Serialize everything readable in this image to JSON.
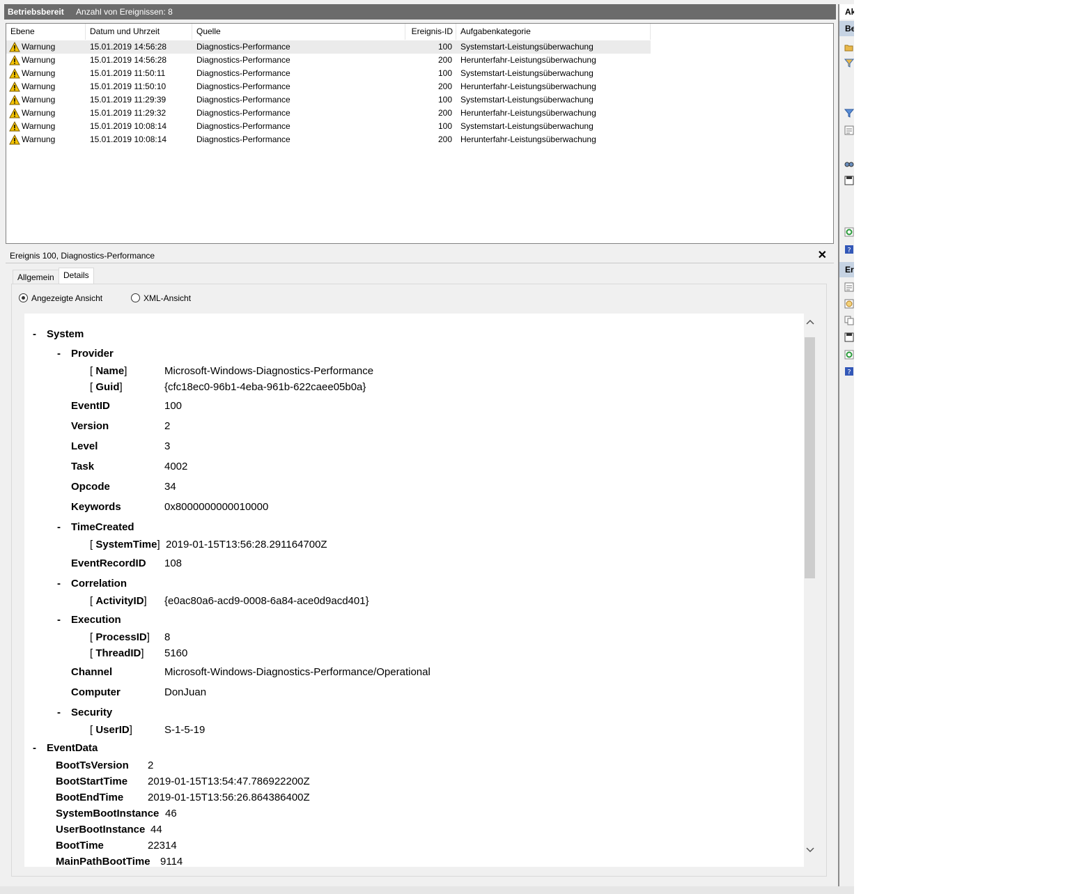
{
  "header": {
    "title": "Betriebsbereit",
    "event_count": "Anzahl von Ereignissen: 8"
  },
  "event_list": {
    "columns": [
      "Ebene",
      "Datum und Uhrzeit",
      "Quelle",
      "Ereignis-ID",
      "Aufgabenkategorie"
    ],
    "rows": [
      {
        "level": "Warnung",
        "datetime": "15.01.2019 14:56:28",
        "source": "Diagnostics-Performance",
        "id": "100",
        "category": "Systemstart-Leistungsüberwachung"
      },
      {
        "level": "Warnung",
        "datetime": "15.01.2019 14:56:28",
        "source": "Diagnostics-Performance",
        "id": "200",
        "category": "Herunterfahr-Leistungsüberwachung"
      },
      {
        "level": "Warnung",
        "datetime": "15.01.2019 11:50:11",
        "source": "Diagnostics-Performance",
        "id": "100",
        "category": "Systemstart-Leistungsüberwachung"
      },
      {
        "level": "Warnung",
        "datetime": "15.01.2019 11:50:10",
        "source": "Diagnostics-Performance",
        "id": "200",
        "category": "Herunterfahr-Leistungsüberwachung"
      },
      {
        "level": "Warnung",
        "datetime": "15.01.2019 11:29:39",
        "source": "Diagnostics-Performance",
        "id": "100",
        "category": "Systemstart-Leistungsüberwachung"
      },
      {
        "level": "Warnung",
        "datetime": "15.01.2019 11:29:32",
        "source": "Diagnostics-Performance",
        "id": "200",
        "category": "Herunterfahr-Leistungsüberwachung"
      },
      {
        "level": "Warnung",
        "datetime": "15.01.2019 10:08:14",
        "source": "Diagnostics-Performance",
        "id": "100",
        "category": "Systemstart-Leistungsüberwachung"
      },
      {
        "level": "Warnung",
        "datetime": "15.01.2019 10:08:14",
        "source": "Diagnostics-Performance",
        "id": "200",
        "category": "Herunterfahr-Leistungsüberwachung"
      }
    ]
  },
  "detail": {
    "title": "Ereignis 100, Diagnostics-Performance",
    "close": "✕",
    "tabs": [
      "Allgemein",
      "Details"
    ],
    "views": [
      "Angezeigte Ansicht",
      "XML-Ansicht"
    ],
    "collapse": "-",
    "tree": {
      "system": "System",
      "provider": "Provider",
      "name_key": "Name",
      "name_val": "Microsoft-Windows-Diagnostics-Performance",
      "guid_key": "Guid",
      "guid_val": "{cfc18ec0-96b1-4eba-961b-622caee05b0a}",
      "eventid_key": "EventID",
      "eventid_val": "100",
      "version_key": "Version",
      "version_val": "2",
      "level_key": "Level",
      "level_val": "3",
      "task_key": "Task",
      "task_val": "4002",
      "opcode_key": "Opcode",
      "opcode_val": "34",
      "keywords_key": "Keywords",
      "keywords_val": "0x8000000000010000",
      "timecreated": "TimeCreated",
      "systemtime_key": "SystemTime",
      "systemtime_val": "2019-01-15T13:56:28.291164700Z",
      "eventrecordid_key": "EventRecordID",
      "eventrecordid_val": "108",
      "correlation": "Correlation",
      "activityid_key": "ActivityID",
      "activityid_val": "{e0ac80a6-acd9-0008-6a84-ace0d9acd401}",
      "execution": "Execution",
      "processid_key": "ProcessID",
      "processid_val": "8",
      "threadid_key": "ThreadID",
      "threadid_val": "5160",
      "channel_key": "Channel",
      "channel_val": "Microsoft-Windows-Diagnostics-Performance/Operational",
      "computer_key": "Computer",
      "computer_val": "DonJuan",
      "security": "Security",
      "userid_key": "UserID",
      "userid_val": "S-1-5-19",
      "eventdata": "EventData",
      "boottsversion_key": "BootTsVersion",
      "boottsversion_val": "2",
      "bootstarttime_key": "BootStartTime",
      "bootstarttime_val": "2019-01-15T13:54:47.786922200Z",
      "bootendtime_key": "BootEndTime",
      "bootendtime_val": "2019-01-15T13:56:26.864386400Z",
      "systembootinstance_key": "SystemBootInstance",
      "systembootinstance_val": "46",
      "userbootinstance_key": "UserBootInstance",
      "userbootinstance_val": "44",
      "boottime_key": "BootTime",
      "boottime_val": "22314",
      "mainpathboottime_key": "MainPathBootTime",
      "mainpathboottime_val": "9114"
    }
  },
  "right_pane": {
    "heading": "Ak",
    "section1": "Be",
    "section2": "Er",
    "icons": [
      "open-folder-icon",
      "filter-icon",
      "filter-icon",
      "properties-icon",
      "find-icon",
      "save-icon",
      "refresh-icon",
      "help-icon",
      "event-properties-icon",
      "attach-task-icon",
      "copy-icon",
      "save-icon",
      "refresh-icon",
      "help-icon"
    ]
  },
  "colors": {
    "header_bg": "#6b6b6b",
    "selected_row": "#ebebeb",
    "warning_yellow": "#f5c400",
    "pane_blue": "#c6d3e3"
  }
}
